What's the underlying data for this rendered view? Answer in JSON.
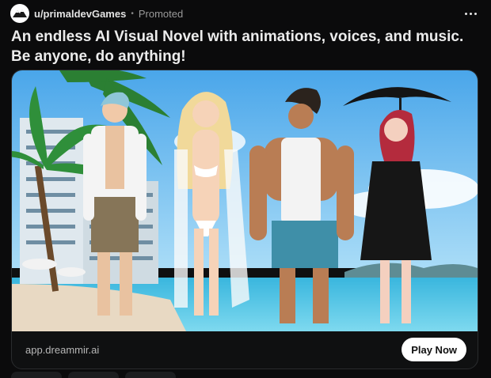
{
  "post": {
    "author": "u/primaldevGames",
    "separator": "•",
    "promoted_label": "Promoted",
    "title": "An endless AI Visual Novel with animations, voices, and music. Be anyone, do anything!",
    "domain": "app.dreammir.ai",
    "cta_label": "Play Now"
  },
  "icons": {
    "avatar": "mountain-logo-icon",
    "more": "more-options-icon"
  },
  "colors": {
    "background": "#0b0b0c",
    "cta_background": "#ffffff",
    "sky": "#7fc6f2",
    "ocean": "#2db4dc"
  }
}
